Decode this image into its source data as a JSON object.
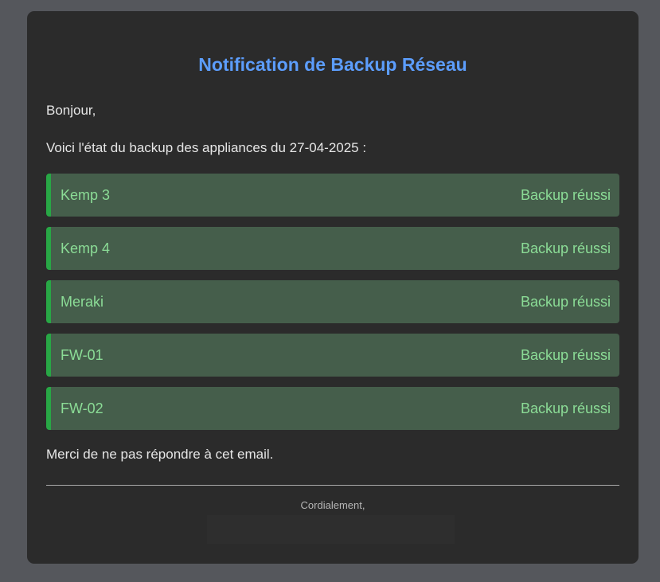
{
  "email": {
    "title": "Notification de Backup Réseau",
    "greeting": "Bonjour,",
    "intro": "Voici l'état du backup des appliances du 27-04-2025 :",
    "status_color": "#28a745",
    "appliances": [
      {
        "name": "Kemp 3",
        "status": "Backup réussi"
      },
      {
        "name": "Kemp 4",
        "status": "Backup réussi"
      },
      {
        "name": "Meraki",
        "status": "Backup réussi"
      },
      {
        "name": "FW-01",
        "status": "Backup réussi"
      },
      {
        "name": "FW-02",
        "status": "Backup réussi"
      }
    ],
    "footer_note": "Merci de ne pas répondre à cet email.",
    "signoff": "Cordialement,"
  }
}
